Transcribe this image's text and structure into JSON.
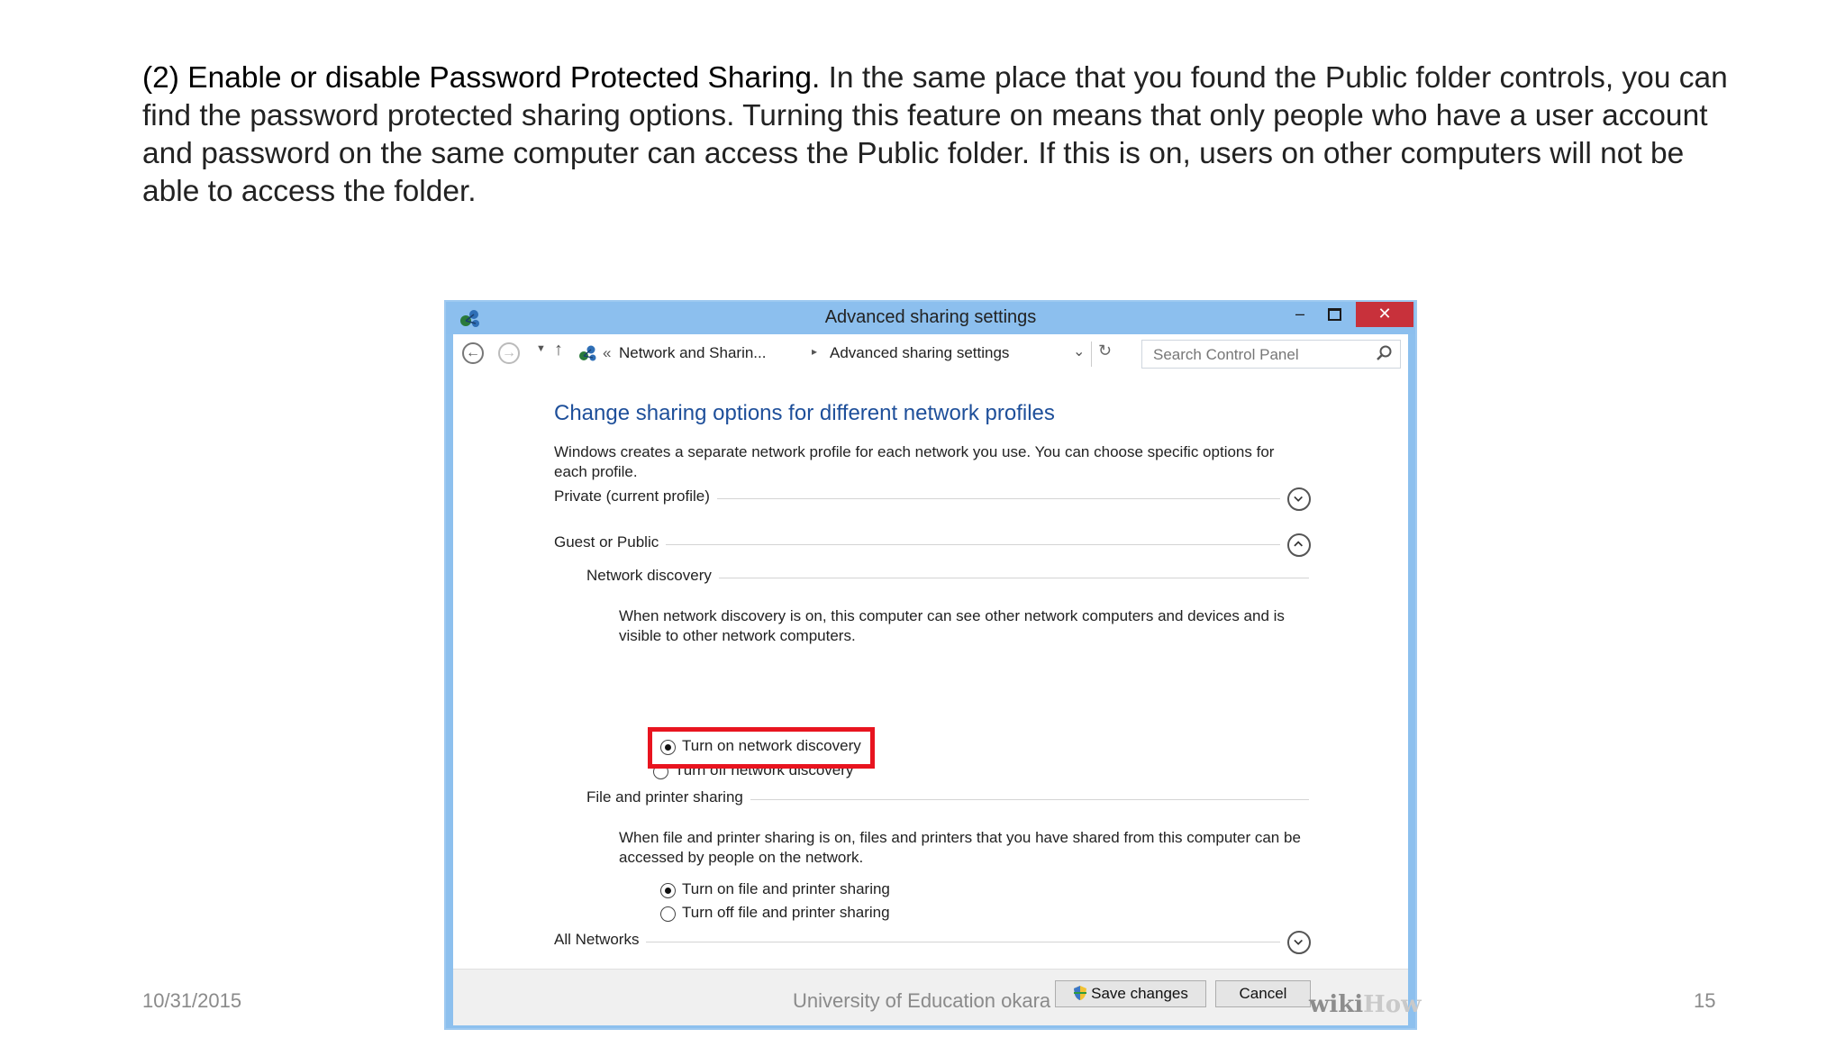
{
  "slide": {
    "lead": "(2) Enable or disable Password Protected Sharing.",
    "body": " In the same place that you found the Public folder controls, you can find the password protected sharing options. Turning this feature on means that only people who have a user account and password on the same computer can access the Public folder. If this is on, users on other computers will not be able to access the folder.",
    "footer_date": "10/31/2015",
    "footer_center": "University of Education okara",
    "page_number": "15"
  },
  "window": {
    "title": "Advanced sharing settings",
    "controls": {
      "minimize": "–",
      "close": "✕"
    },
    "address": {
      "overflow_chevrons": "«",
      "crumbs": [
        "Network and Sharin...",
        "Advanced sharing settings"
      ],
      "search_placeholder": "Search Control Panel"
    },
    "content": {
      "heading": "Change sharing options for different network profiles",
      "description": "Windows creates a separate network profile for each network you use. You can choose specific options for each profile.",
      "profiles": {
        "private": {
          "label": "Private (current profile)",
          "expanded": false
        },
        "guest": {
          "label": "Guest or Public",
          "expanded": true
        },
        "all": {
          "label": "All Networks",
          "expanded": false
        }
      },
      "network_discovery": {
        "label": "Network discovery",
        "description": "When network discovery is on, this computer can see other network computers and devices and is visible to other network computers.",
        "options": [
          "Turn on network discovery",
          "Turn off network discovery"
        ],
        "selected": "Turn on network discovery"
      },
      "file_printer_sharing": {
        "label": "File and printer sharing",
        "description": "When file and printer sharing is on, files and printers that you have shared from this computer can be accessed by people on the network.",
        "options": [
          "Turn on file and printer sharing",
          "Turn off file and printer sharing"
        ],
        "selected": "Turn on file and printer sharing"
      }
    },
    "footer": {
      "save_label": "Save changes",
      "cancel_label": "Cancel"
    },
    "watermark": {
      "part1": "wiki",
      "part2": "How"
    }
  },
  "colors": {
    "heading_blue": "#1e4f9a",
    "titlebar_blue": "#8cbfee",
    "close_red": "#c8313b",
    "highlight_red": "#e8141f"
  },
  "icons": [
    "network-icon",
    "back-arrow-icon",
    "forward-arrow-icon",
    "up-arrow-icon",
    "refresh-icon",
    "search-icon",
    "chevron-down-icon",
    "chevron-up-icon",
    "shield-icon"
  ]
}
